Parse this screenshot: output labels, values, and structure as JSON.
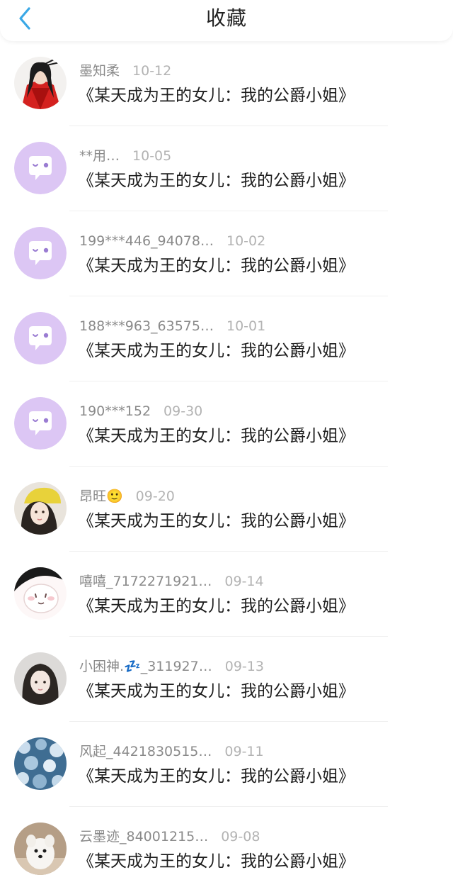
{
  "header": {
    "title": "收藏",
    "back_icon": "chevron-left-icon",
    "accent_color": "#3aa8e6"
  },
  "items": [
    {
      "username": "墨知柔",
      "date": "10-12",
      "title": "《某天成为王的女儿：我的公爵小姐》",
      "avatar": "red-robed-character-avatar"
    },
    {
      "username": "**用…",
      "date": "10-05",
      "title": "《某天成为王的女儿：我的公爵小姐》",
      "avatar": "default-chat-bubble-avatar"
    },
    {
      "username": "199***446_94078…",
      "date": "10-02",
      "title": "《某天成为王的女儿：我的公爵小姐》",
      "avatar": "default-chat-bubble-avatar"
    },
    {
      "username": "188***963_63575…",
      "date": "10-01",
      "title": "《某天成为王的女儿：我的公爵小姐》",
      "avatar": "default-chat-bubble-avatar"
    },
    {
      "username": "190***152",
      "date": "09-30",
      "title": "《某天成为王的女儿：我的公爵小姐》",
      "avatar": "default-chat-bubble-avatar"
    },
    {
      "username": "昂旺🙂",
      "date": "09-20",
      "title": "《某天成为王的女儿：我的公爵小姐》",
      "avatar": "girl-yellow-hat-avatar"
    },
    {
      "username": "嘻嘻_7172271921…",
      "date": "09-14",
      "title": "《某天成为王的女儿：我的公爵小姐》",
      "avatar": "cartoon-bunny-avatar"
    },
    {
      "username": "小困神.💤_311927…",
      "date": "09-13",
      "title": "《某天成为王的女儿：我的公爵小姐》",
      "avatar": "girl-portrait-avatar"
    },
    {
      "username": "风起_4421830515…",
      "date": "09-11",
      "title": "《某天成为王的女儿：我的公爵小姐》",
      "avatar": "blue-texture-avatar"
    },
    {
      "username": "云墨迹_84001215…",
      "date": "09-08",
      "title": "《某天成为王的女儿：我的公爵小姐》",
      "avatar": "white-dog-avatar"
    }
  ]
}
